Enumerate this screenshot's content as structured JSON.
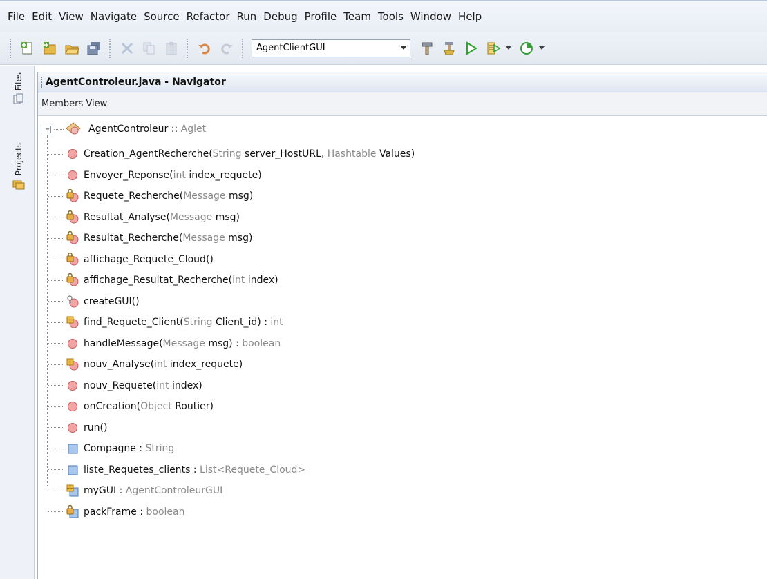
{
  "menu": [
    "File",
    "Edit",
    "View",
    "Navigate",
    "Source",
    "Refactor",
    "Run",
    "Debug",
    "Profile",
    "Team",
    "Tools",
    "Window",
    "Help"
  ],
  "toolbar": {
    "config_value": "AgentClientGUI"
  },
  "sidebar": {
    "files_label": "Files",
    "projects_label": "Projects"
  },
  "navigator": {
    "title": "AgentControleur.java - Navigator",
    "view_label": "Members View",
    "root": {
      "name": "AgentControleur",
      "sep": " :: ",
      "type": "Aglet"
    },
    "members": [
      {
        "icon": "public-method-icon",
        "parts": [
          [
            "n",
            "Creation_AgentRecherche("
          ],
          [
            "g",
            "String"
          ],
          [
            "n",
            " server_HostURL, "
          ],
          [
            "g",
            "Hashtable"
          ],
          [
            "n",
            " Values)"
          ]
        ]
      },
      {
        "icon": "public-method-icon",
        "parts": [
          [
            "n",
            "Envoyer_Reponse("
          ],
          [
            "g",
            "int"
          ],
          [
            "n",
            " index_requete)"
          ]
        ]
      },
      {
        "icon": "private-method-icon",
        "parts": [
          [
            "n",
            "Requete_Recherche("
          ],
          [
            "g",
            "Message"
          ],
          [
            "n",
            " msg)"
          ]
        ]
      },
      {
        "icon": "private-method-icon",
        "parts": [
          [
            "n",
            "Resultat_Analyse("
          ],
          [
            "g",
            "Message"
          ],
          [
            "n",
            " msg)"
          ]
        ]
      },
      {
        "icon": "private-method-icon",
        "parts": [
          [
            "n",
            "Resultat_Recherche("
          ],
          [
            "g",
            "Message"
          ],
          [
            "n",
            " msg)"
          ]
        ]
      },
      {
        "icon": "private-method-icon",
        "parts": [
          [
            "n",
            "affichage_Requete_Cloud()"
          ]
        ]
      },
      {
        "icon": "private-method-icon",
        "parts": [
          [
            "n",
            "affichage_Resultat_Recherche("
          ],
          [
            "g",
            "int"
          ],
          [
            "n",
            " index)"
          ]
        ]
      },
      {
        "icon": "package-method-icon",
        "parts": [
          [
            "n",
            "createGUI()"
          ]
        ]
      },
      {
        "icon": "protected-method-icon",
        "parts": [
          [
            "n",
            "find_Requete_Client("
          ],
          [
            "g",
            "String"
          ],
          [
            "n",
            " Client_id) : "
          ],
          [
            "g",
            "int"
          ]
        ]
      },
      {
        "icon": "public-method-icon",
        "parts": [
          [
            "n",
            "handleMessage("
          ],
          [
            "g",
            "Message"
          ],
          [
            "n",
            " msg) : "
          ],
          [
            "g",
            "boolean"
          ]
        ]
      },
      {
        "icon": "protected-method-icon",
        "parts": [
          [
            "n",
            "nouv_Analyse("
          ],
          [
            "g",
            "int"
          ],
          [
            "n",
            " index_requete)"
          ]
        ]
      },
      {
        "icon": "public-method-icon",
        "parts": [
          [
            "n",
            "nouv_Requete("
          ],
          [
            "g",
            "int"
          ],
          [
            "n",
            " index)"
          ]
        ]
      },
      {
        "icon": "public-method-icon",
        "parts": [
          [
            "n",
            "onCreation("
          ],
          [
            "g",
            "Object"
          ],
          [
            "n",
            " Routier)"
          ]
        ]
      },
      {
        "icon": "public-method-icon",
        "parts": [
          [
            "n",
            "run()"
          ]
        ]
      },
      {
        "icon": "field-icon",
        "parts": [
          [
            "n",
            "Compagne : "
          ],
          [
            "g",
            "String"
          ]
        ]
      },
      {
        "icon": "field-icon",
        "parts": [
          [
            "n",
            "liste_Requetes_clients : "
          ],
          [
            "g",
            "List<Requete_Cloud>"
          ]
        ]
      },
      {
        "icon": "protected-field-icon",
        "parts": [
          [
            "n",
            "myGUI : "
          ],
          [
            "g",
            "AgentControleurGUI"
          ]
        ]
      },
      {
        "icon": "private-field-icon",
        "parts": [
          [
            "n",
            "packFrame : "
          ],
          [
            "g",
            "boolean"
          ]
        ]
      }
    ]
  }
}
